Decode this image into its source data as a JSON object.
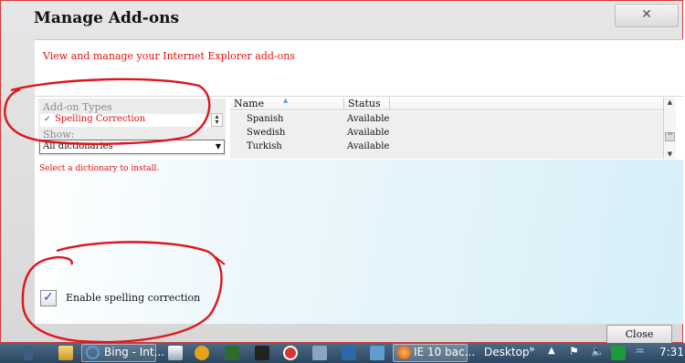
{
  "window": {
    "title": "Manage Add-ons",
    "close_glyph": "✕"
  },
  "header": {
    "text": "View and manage your Internet Explorer add-ons"
  },
  "left_panel": {
    "addon_types_label": "Add-on Types",
    "addon_types_selected": "Spelling Correction",
    "show_label": "Show:",
    "show_value": "All dictionaries"
  },
  "list": {
    "columns": [
      "Name",
      "Status"
    ],
    "rows": [
      {
        "name": "Spanish",
        "status": "Available"
      },
      {
        "name": "Swedish",
        "status": "Available"
      },
      {
        "name": "Turkish",
        "status": "Available"
      }
    ]
  },
  "detail": {
    "hint": "Select a dictionary to install.",
    "enable_label": "Enable spelling correction",
    "enable_checked": true
  },
  "footer": {
    "close_label": "Close"
  },
  "taskbar": {
    "bing_label": "Bing - Int...",
    "ie_label": "IE 10 bac...",
    "desktop_label": "Desktop",
    "desktop_chevron": "»",
    "clock": "7:31"
  },
  "colors": {
    "annotation_red": "#e0141a",
    "header_red": "#e01010",
    "taskbar": "#2a4660"
  }
}
